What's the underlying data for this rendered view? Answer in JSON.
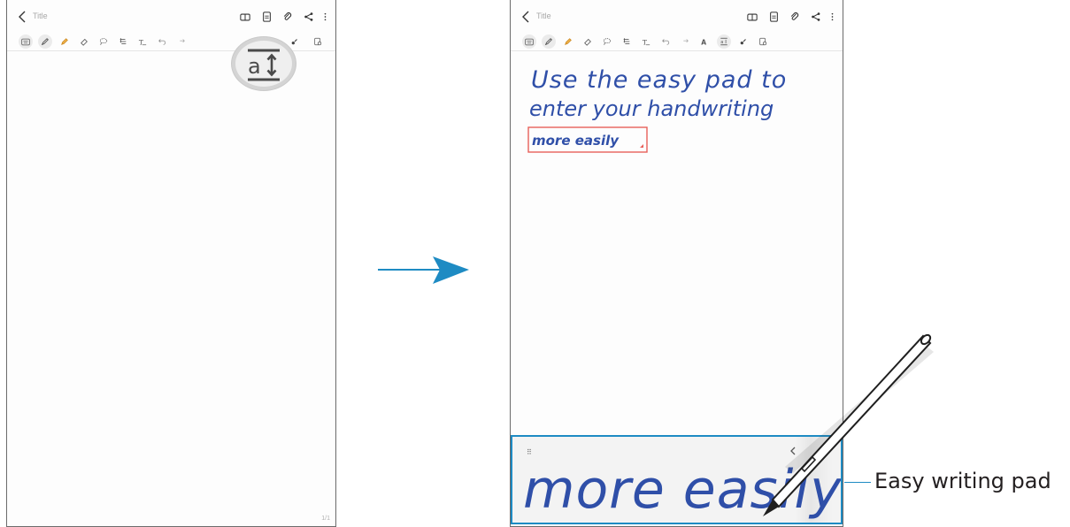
{
  "left_screen": {
    "title": "Title",
    "page_indicator": "1/1",
    "magnified_icon": "easy-writing-pad-icon"
  },
  "right_screen": {
    "title": "Title",
    "handwriting_lines": [
      "Use the easy pad to",
      "enter your handwriting",
      "more easily"
    ]
  },
  "easy_writing_pad": {
    "handwriting": "more easily",
    "label": "Easy writing pad"
  },
  "colors": {
    "ink": "#2f4fa8",
    "accent": "#1e8bc3",
    "selection": "#e8605a",
    "arrow": "#1e8bc3"
  },
  "icons": {
    "topbar": [
      "back-icon",
      "book-view-icon",
      "page-layout-icon",
      "attach-icon",
      "share-icon",
      "more-options-icon"
    ],
    "toolbar": [
      "keyboard-icon",
      "pen-icon",
      "highlighter-icon",
      "eraser-icon",
      "lasso-icon",
      "text-style-icon",
      "text-edit-icon",
      "undo-icon",
      "redo-icon",
      "handwriting-search-icon",
      "easy-writing-pad-icon",
      "pen-color-icon",
      "read-mode-icon"
    ]
  }
}
